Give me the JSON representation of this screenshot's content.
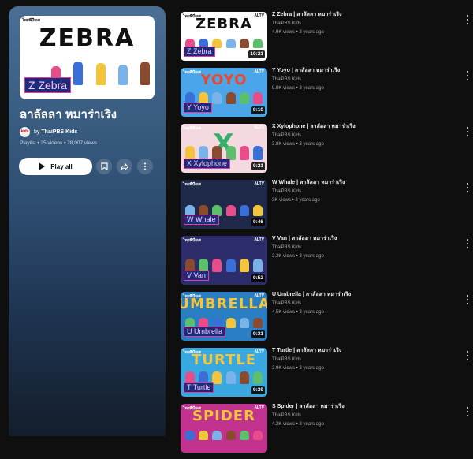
{
  "playlist": {
    "thumb_word": "ZEBRA",
    "thumb_label": "Z Zebra",
    "title": "ลาลัลลา หมาร่าเริง",
    "owner_by": "by",
    "owner_name": "ThaiPBS Kids",
    "owner_avatar_text": "kids",
    "meta": "Playlist • 25 videos • 28,007 views",
    "play_all_label": "Play all",
    "icons": [
      "save-icon",
      "share-icon",
      "more-icon"
    ]
  },
  "videos": [
    {
      "title": "Z Zebra | ลาลัลลา หมาร่าเริง",
      "channel": "ThaiPBS Kids",
      "stats": "4.9K views • 3 years ago",
      "duration": "10:21",
      "word": "ZEBRA",
      "label": "Z Zebra",
      "bg": "#ffffff",
      "word_color": "#111111"
    },
    {
      "title": "Y Yoyo | ลาลัลลา หมาร่าเริง",
      "channel": "ThaiPBS Kids",
      "stats": "9.8K views • 3 years ago",
      "duration": "9:10",
      "word": "YOYO",
      "label": "Y Yoyo",
      "bg": "#4aa6e8",
      "word_color": "#e64a2e"
    },
    {
      "title": "X Xylophone | ลาลัลลา หมาร่าเริง",
      "channel": "ThaiPBS Kids",
      "stats": "3.8K views • 3 years ago",
      "duration": "9:21",
      "word": "X",
      "label": "X Xylophone",
      "bg": "#f4d9e0",
      "word_color": "#33b06a"
    },
    {
      "title": "W Whale | ลาลัลลา หมาร่าเริง",
      "channel": "ThaiPBS Kids",
      "stats": "3K views • 3 years ago",
      "duration": "9:46",
      "word": "",
      "label": "W Whale",
      "bg": "#1f2a4a",
      "word_color": "#ffffff"
    },
    {
      "title": "V Van | ลาลัลลา หมาร่าเริง",
      "channel": "ThaiPBS Kids",
      "stats": "2.2K views • 3 years ago",
      "duration": "9:52",
      "word": "",
      "label": "V Van",
      "bg": "#2e2d6b",
      "word_color": "#ffffff"
    },
    {
      "title": "U Umbrella | ลาลัลลา หมาร่าเริง",
      "channel": "ThaiPBS Kids",
      "stats": "4.5K views • 3 years ago",
      "duration": "9:31",
      "word": "UMBRELLA",
      "label": "U Umbrella",
      "bg": "#2a7fc4",
      "word_color": "#f2c53d"
    },
    {
      "title": "T Turtle | ลาลัลลา หมาร่าเริง",
      "channel": "ThaiPBS Kids",
      "stats": "2.9K views • 3 years ago",
      "duration": "9:39",
      "word": "TURTLE",
      "label": "T Turtle",
      "bg": "#3aa8e0",
      "word_color": "#f2c53d"
    },
    {
      "title": "S Spider | ลาลัลลา หมาร่าเริง",
      "channel": "ThaiPBS Kids",
      "stats": "4.2K views • 3 years ago",
      "duration": "",
      "word": "SPIDER",
      "label": "",
      "bg": "#c2338f",
      "word_color": "#f2c53d"
    }
  ],
  "thumb_badges": {
    "left": "ไทยพีบีเอส",
    "right": "ALTV"
  },
  "colors": {
    "accent_label_bg": "#1d2c79",
    "accent_label_border": "#e43aa5",
    "background": "#0f0f0f"
  }
}
